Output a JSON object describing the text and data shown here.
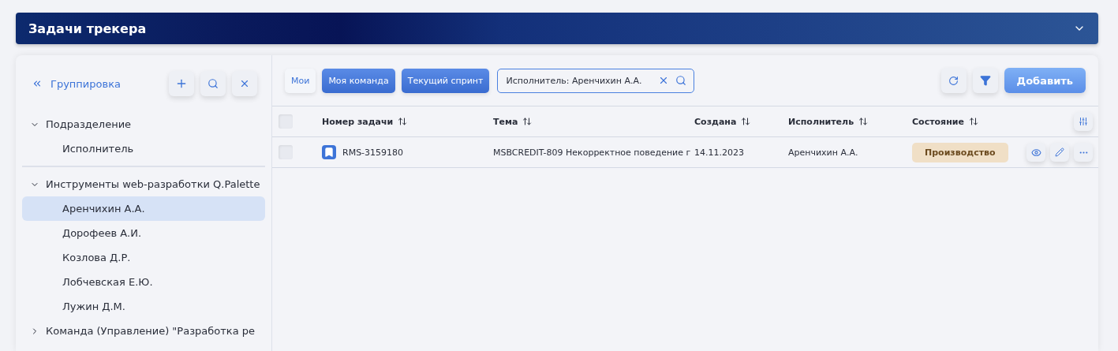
{
  "header": {
    "title": "Задачи трекера"
  },
  "sidebar": {
    "title": "Группировка",
    "tree": [
      {
        "label": "Подразделение",
        "expanded": true,
        "selected": false,
        "children": [
          {
            "label": "Исполнитель",
            "selected": false
          }
        ]
      },
      {
        "label": "Инструменты web-разработки Q.Palette",
        "expanded": true,
        "selected": false,
        "children": [
          {
            "label": "Аренчихин А.А.",
            "selected": true
          },
          {
            "label": "Дорофеев А.И.",
            "selected": false
          },
          {
            "label": "Козлова Д.Р.",
            "selected": false
          },
          {
            "label": "Лобчевская Е.Ю.",
            "selected": false
          },
          {
            "label": "Лужин Д.М.",
            "selected": false
          }
        ]
      },
      {
        "label": "Команда (Управление) \"Разработка ре",
        "expanded": false,
        "selected": false
      }
    ]
  },
  "filters": [
    {
      "label": "Мои",
      "selected": false
    },
    {
      "label": "Моя команда",
      "selected": true
    },
    {
      "label": "Текущий спринт",
      "selected": true
    }
  ],
  "search": {
    "value": "Исполнитель: Аренчихин А.А."
  },
  "add_button": "Добавить",
  "table": {
    "all_checked": false,
    "columns": [
      "Номер задачи",
      "Тема",
      "Создана",
      "Исполнитель",
      "Состояние"
    ],
    "rows": [
      {
        "checked": false,
        "number": "RMS-3159180",
        "topic": "MSBCREDIT-809 Некорректное поведение г",
        "created": "14.11.2023",
        "assignee": "Аренчихин А.А.",
        "status": "Производство"
      }
    ]
  }
}
